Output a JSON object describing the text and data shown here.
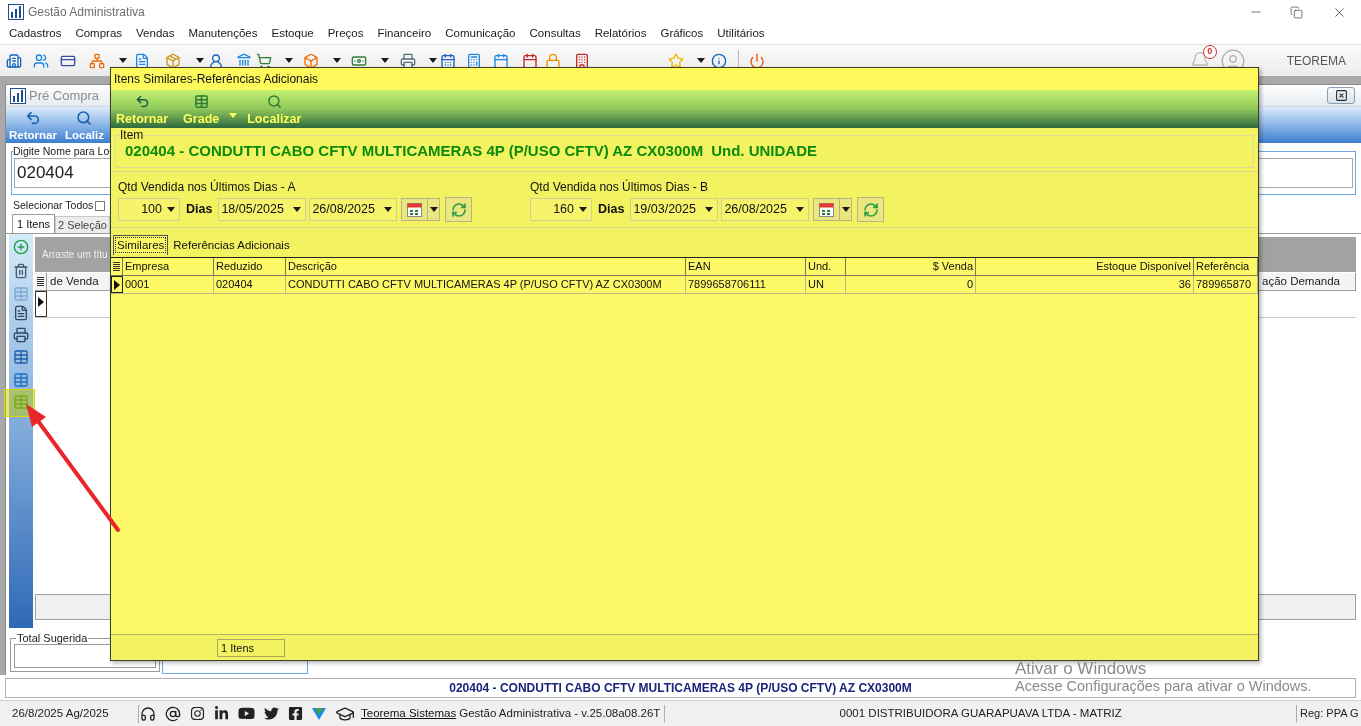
{
  "window": {
    "title": "Gestão Administrativa"
  },
  "menu": [
    "Cadastros",
    "Compras",
    "Vendas",
    "Manutenções",
    "Estoque",
    "Preços",
    "Financeiro",
    "Comunicação",
    "Consultas",
    "Relatórios",
    "Gráficos",
    "Utilitários"
  ],
  "toolbar": {
    "notification_count": "0",
    "user": "TEOREMA"
  },
  "pre_compra": {
    "title": "Pré Compra",
    "toolbar": [
      "Retornar",
      "Localiz"
    ],
    "search": {
      "label": "Digite Nome para Lo",
      "value": "020404"
    },
    "select_all": {
      "label": "Selecionar Todos",
      "checked": false
    },
    "tabs": [
      {
        "label": "1 Itens",
        "selected": true
      },
      {
        "label": "2 Seleção",
        "selected": false
      }
    ],
    "grid": {
      "group_hint": "Arraste um títu",
      "columns": [
        "de Venda",
        "ação Demanda"
      ],
      "rows": [
        {
          "selected": true
        }
      ]
    },
    "totals": {
      "label": "Total Sugerida"
    }
  },
  "dialog": {
    "title": "Itens Similares-Referências Adicionais",
    "toolbar": [
      {
        "label": "Retornar",
        "dropdown": false
      },
      {
        "label": "Grade",
        "dropdown": true
      },
      {
        "label": "Localizar",
        "dropdown": false
      }
    ],
    "item": {
      "label": "Item",
      "description": "020404 - CONDUTTI CABO CFTV MULTICAMERAS 4P (P/USO CFTV) AZ CX0300M",
      "unit": "Und. UNIDADE"
    },
    "periods": [
      {
        "label": "Qtd Vendida nos Últimos Dias - A",
        "days": "100",
        "days_label": "Dias",
        "from": "18/05/2025",
        "to": "26/08/2025"
      },
      {
        "label": "Qtd Vendida nos Últimos Dias - B",
        "days": "160",
        "days_label": "Dias",
        "from": "19/03/2025",
        "to": "26/08/2025"
      }
    ],
    "tabs": [
      {
        "label": "Similares",
        "selected": true
      },
      {
        "label": "Referências Adicionais",
        "selected": false
      }
    ],
    "table": {
      "columns": [
        "Empresa",
        "Reduzido",
        "Descrição",
        "EAN",
        "Und.",
        "$ Venda",
        "Estoque Disponível",
        "Referência"
      ],
      "rows": [
        {
          "selected": true,
          "cells": [
            "0001",
            "020404",
            "CONDUTTI CABO CFTV MULTICAMERAS 4P (P/USO CFTV) AZ CX0300M",
            "7899658706111",
            "UN",
            "0",
            "36",
            "789965870"
          ]
        }
      ]
    },
    "footer": {
      "count": "1 Itens"
    }
  },
  "status_line": "020404 - CONDUTTI CABO CFTV MULTICAMERAS 4P (P/USO CFTV) AZ CX0300M",
  "status_bar": {
    "date": "26/8/2025 Ag/2025",
    "link": "Teorema Sistemas",
    "version": "Gestão Administrativa - v.25.08a08.26T",
    "company": "0001 DISTRIBUIDORA GUARAPUAVA LTDA - MATRIZ",
    "register": "Reg: PPA G"
  },
  "windows_notice": {
    "title": "Ativar o Windows",
    "message": "Acesse Configurações para ativar o Windows."
  }
}
